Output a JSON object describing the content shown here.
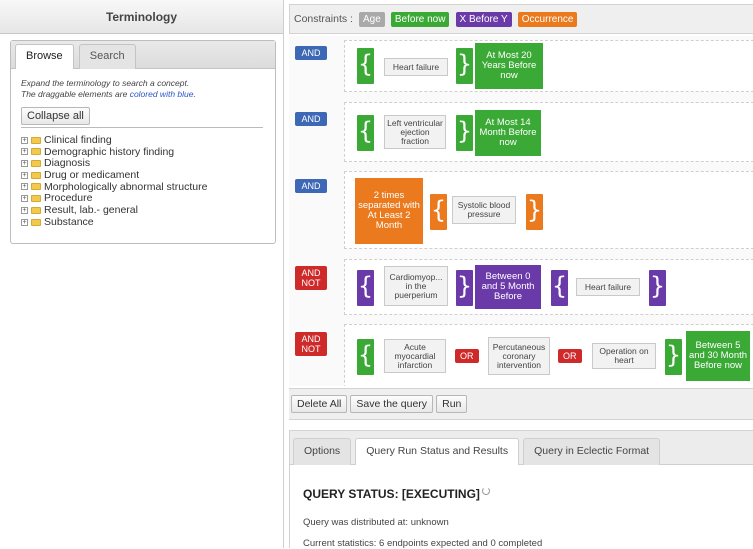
{
  "terminology": {
    "title": "Terminology",
    "tabs": [
      {
        "label": "Browse",
        "active": true
      },
      {
        "label": "Search",
        "active": false
      }
    ],
    "hint_line1": "Expand the terminology to search a concept.",
    "hint_line2_prefix": "The draggable elements are ",
    "hint_line2_highlight": "colored with blue",
    "hint_line2_suffix": ".",
    "collapse_label": "Collapse all",
    "tree": [
      "Clinical finding",
      "Demographic history finding",
      "Diagnosis",
      "Drug or medicament",
      "Morphologically abnormal structure",
      "Procedure",
      "Result, lab.- general",
      "Substance"
    ]
  },
  "constraints": {
    "label": "Constraints :",
    "tags": [
      {
        "label": "Age",
        "color": "#a9a9a9"
      },
      {
        "label": "Before now",
        "color": "#3aa935"
      },
      {
        "label": "X Before Y",
        "color": "#6a3aa8"
      },
      {
        "label": "Occurrence",
        "color": "#ea7a1d"
      }
    ]
  },
  "query": {
    "rows": [
      {
        "op": "AND",
        "concepts": [
          "Heart failure"
        ],
        "temporal": "At Most 20 Years Before now"
      },
      {
        "op": "AND",
        "concepts": [
          "Left ventricular ejection fraction"
        ],
        "temporal": "At Most 14 Month Before now"
      },
      {
        "op": "AND",
        "occurrence": "2 times separated with At Least 2 Month",
        "concepts": [
          "Systolic blood pressure"
        ]
      },
      {
        "op": "AND NOT",
        "concepts": [
          "Cardiomyop... in the puerperium",
          "Heart failure"
        ],
        "temporal": "Between 0 and 5 Month Before"
      },
      {
        "op": "AND NOT",
        "concepts": [
          "Acute myocardial infarction",
          "Percutaneous coronary intervention",
          "Operation on heart"
        ],
        "or_label": "OR",
        "temporal": "Between 5 and 30 Month Before now"
      }
    ]
  },
  "actions": {
    "delete_all": "Delete All",
    "save": "Save the query",
    "run": "Run"
  },
  "results": {
    "tabs": [
      {
        "label": "Options",
        "active": false
      },
      {
        "label": "Query Run Status and Results",
        "active": true
      },
      {
        "label": "Query in Eclectic Format",
        "active": false
      }
    ],
    "status": "QUERY STATUS: [EXECUTING]",
    "distributed": "Query was distributed at: unknown",
    "statistics": "Current statistics: 6 endpoints expected and 0 completed"
  }
}
